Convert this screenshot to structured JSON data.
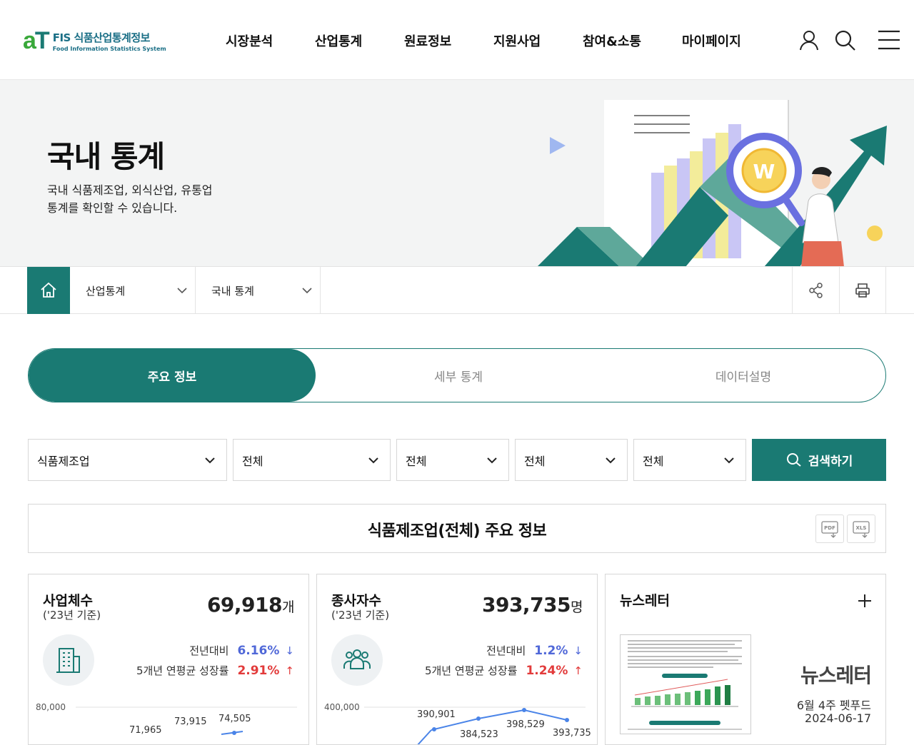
{
  "header": {
    "logo_mark_a": "a",
    "logo_mark_t": "T",
    "logo_title": "FIS 식품산업통계정보",
    "logo_subtitle": "Food Information Statistics System",
    "nav": [
      "시장분석",
      "산업통계",
      "원료정보",
      "지원사업",
      "참여&소통",
      "마이페이지"
    ],
    "icons": [
      "user-icon",
      "search-icon",
      "menu-icon"
    ]
  },
  "hero": {
    "title": "국내 통계",
    "desc_line1": "국내 식품제조업, 외식산업, 유통업",
    "desc_line2": "통계를 확인할 수 있습니다.",
    "coin_label": "W"
  },
  "breadcrumb": {
    "level1": "산업통계",
    "level2": "국내 통계",
    "icons": [
      "home-icon",
      "share-icon",
      "print-icon"
    ]
  },
  "tabs": [
    "주요 정보",
    "세부 통계",
    "데이터설명"
  ],
  "filters": {
    "selects": [
      "식품제조업",
      "전체",
      "전체",
      "전체",
      "전체"
    ],
    "search_label": "검색하기"
  },
  "section": {
    "title": "식품제조업(전체) 주요 정보",
    "pdf_label": "PDF",
    "xls_label": "XLS"
  },
  "cards": {
    "business": {
      "title": "사업체수",
      "sub": "('23년 기준)",
      "value": "69,918",
      "unit": "개",
      "yoy_label": "전년대비",
      "yoy_value": "6.16%",
      "yoy_arrow": "↓",
      "cagr_label": "5개년 연평균 성장률",
      "cagr_value": "2.91%",
      "cagr_arrow": "↑",
      "chart_ymax_label": "80,000",
      "chart_labels": [
        "71,965",
        "73,915",
        "74,505"
      ]
    },
    "employees": {
      "title": "종사자수",
      "sub": "('23년 기준)",
      "value": "393,735",
      "unit": "명",
      "yoy_label": "전년대비",
      "yoy_value": "1.2%",
      "yoy_arrow": "↓",
      "cagr_label": "5개년 연평균 성장률",
      "cagr_value": "1.24%",
      "cagr_arrow": "↑",
      "chart_ymax_label": "400,000",
      "chart_labels": [
        "390,901",
        "398,529",
        "384,523",
        "393,735"
      ]
    },
    "newsletter": {
      "title": "뉴스레터",
      "big_label": "뉴스레터",
      "issue": "6월 4주 펫푸드",
      "date": "2024-06-17"
    }
  },
  "colors": {
    "brand": "#1a7a73",
    "down": "#5068d8",
    "up": "#e23b3b"
  }
}
